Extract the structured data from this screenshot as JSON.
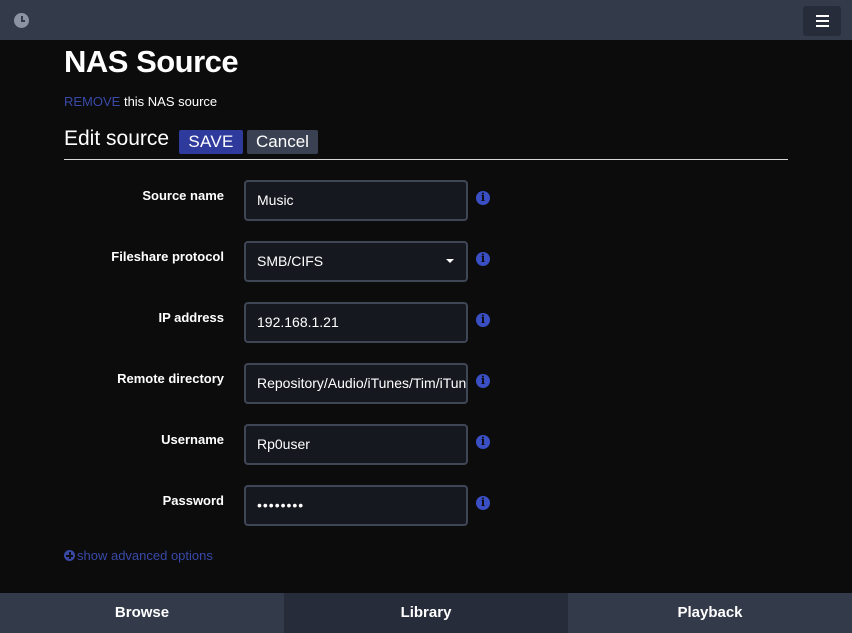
{
  "header": {
    "menu_icon": "hamburger-icon",
    "clock_icon": "clock-icon"
  },
  "title": "NAS Source",
  "remove": {
    "link": "REMOVE",
    "rest": " this NAS source"
  },
  "edit": {
    "heading": "Edit source",
    "save_label": "SAVE",
    "cancel_label": "Cancel"
  },
  "fields": [
    {
      "label": "Source name",
      "value": "Music",
      "type": "text"
    },
    {
      "label": "Fileshare protocol",
      "value": "SMB/CIFS",
      "type": "select"
    },
    {
      "label": "IP address",
      "value": "192.168.1.21",
      "type": "text"
    },
    {
      "label": "Remote directory",
      "value": "Repository/Audio/iTunes/Tim/iTunes Music",
      "type": "text"
    },
    {
      "label": "Username",
      "value": "Rp0user",
      "type": "text"
    },
    {
      "label": "Password",
      "value": "••••••••",
      "type": "password"
    }
  ],
  "advanced_label": "show advanced options",
  "nav": {
    "browse": "Browse",
    "library": "Library",
    "playback": "Playback"
  },
  "colors": {
    "accent": "#2e3b9c",
    "link": "#3949a8",
    "bar": "#333a4a",
    "background": "#0c0c0c"
  }
}
